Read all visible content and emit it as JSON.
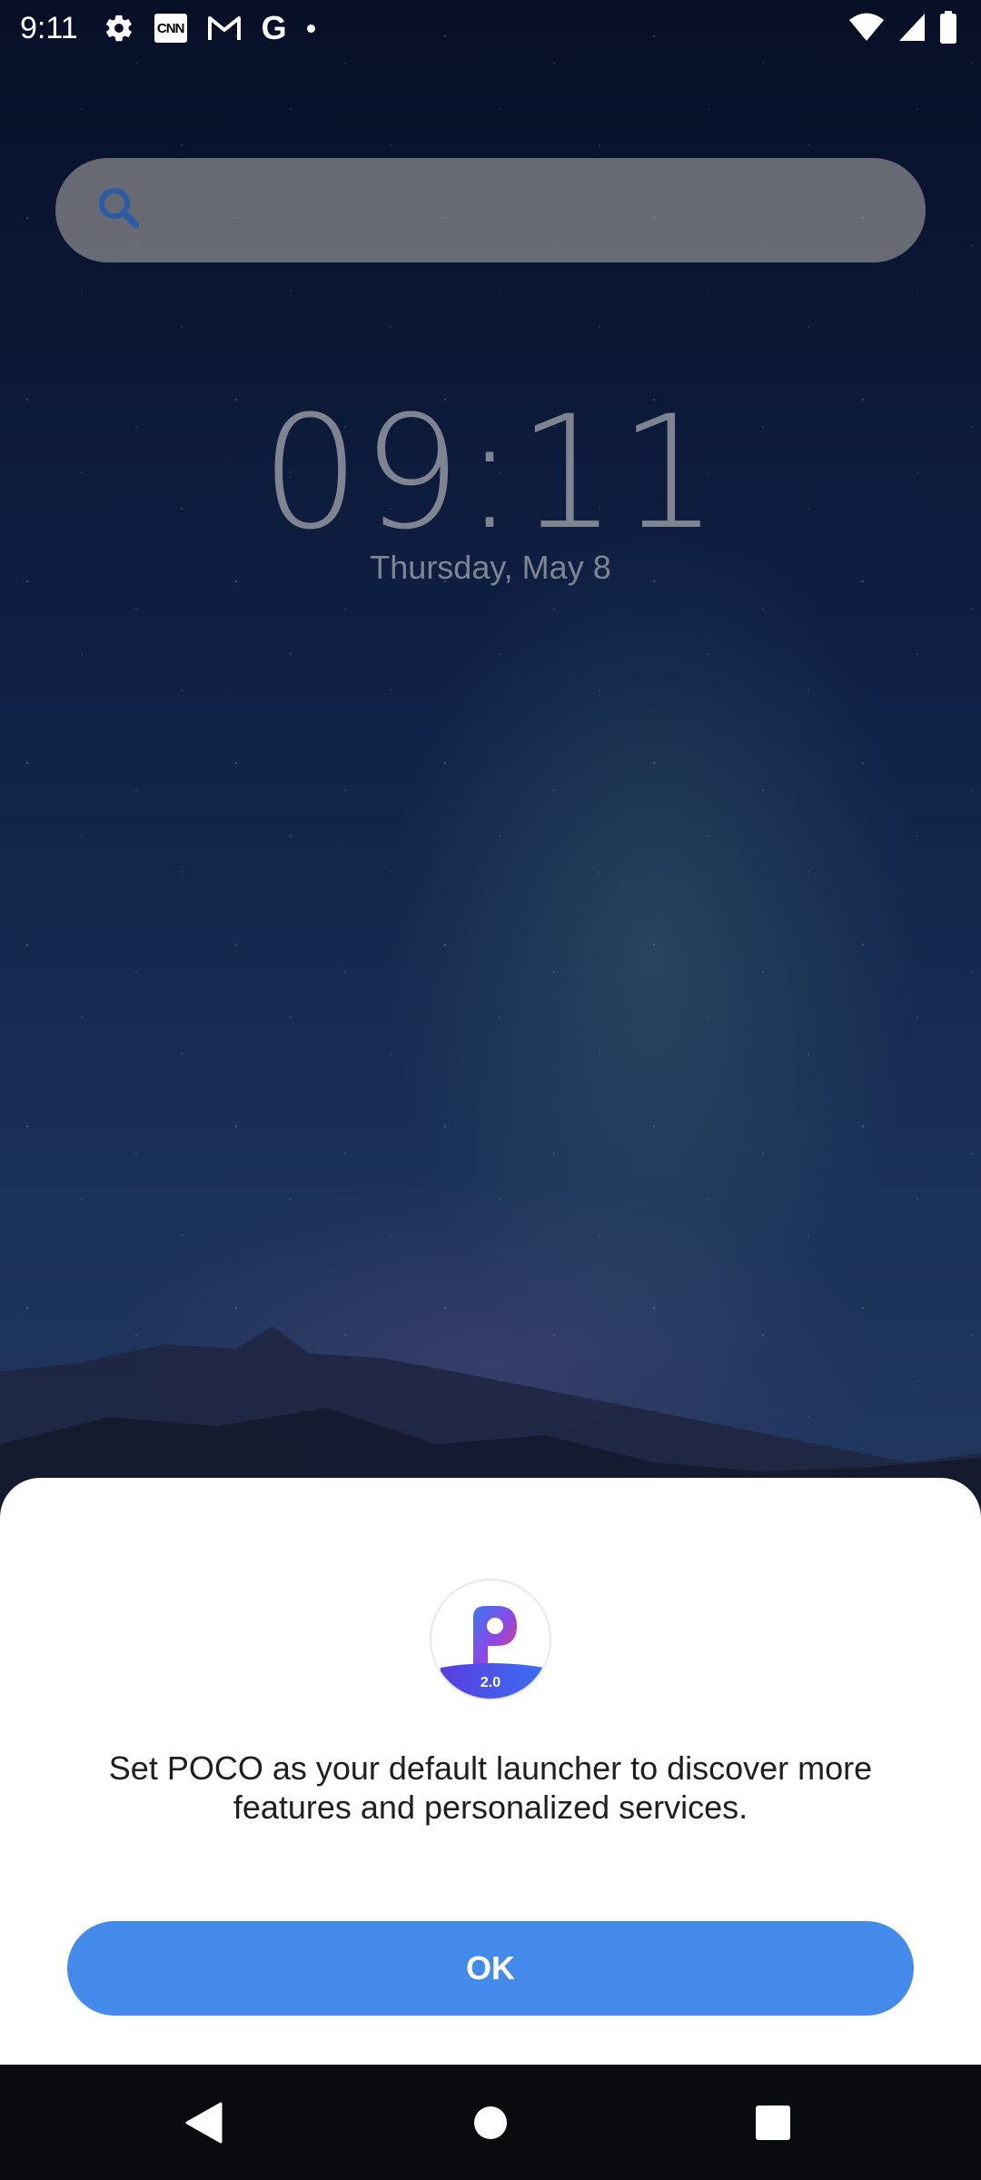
{
  "status_bar": {
    "time": "9:11",
    "notification_icons": [
      "gear-icon",
      "cnn-icon",
      "gmail-icon",
      "google-icon",
      "dot-icon"
    ],
    "cnn_label": "CNN",
    "google_label": "G",
    "system_icons": [
      "wifi-icon",
      "signal-icon",
      "battery-icon"
    ]
  },
  "search": {
    "placeholder": ""
  },
  "clock": {
    "time": "09:11",
    "date": "Thursday, May 8"
  },
  "dialog": {
    "logo_version": "2.0",
    "message": "Set POCO as your default launcher to discover more features and personalized services.",
    "ok_label": "OK",
    "accent_color": "#448aea"
  },
  "nav_bar": {
    "buttons": [
      "back-icon",
      "home-icon",
      "recents-icon"
    ]
  }
}
